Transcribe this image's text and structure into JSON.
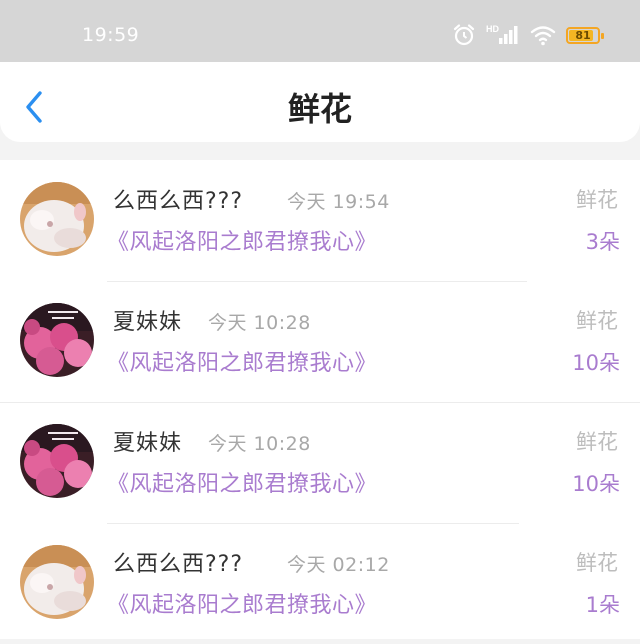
{
  "status_bar": {
    "time": "19:59",
    "hd_label": "HD",
    "battery_level": "81",
    "battery_fraction": 0.81,
    "icons": [
      "alarm-icon",
      "signal-icon",
      "wifi-icon",
      "battery-icon"
    ]
  },
  "header": {
    "title": "鲜花",
    "back_icon": "chevron-left-icon"
  },
  "colors": {
    "accent": "#a97ccf",
    "back": "#2b8ff0",
    "status_bar": "#d6d6d6",
    "battery": "#f4a623"
  },
  "items": [
    {
      "avatar": "kitten-avatar",
      "name": "么西么西???",
      "time": "今天 19:54",
      "book": "《风起洛阳之郎君撩我心》",
      "gift_type": "鲜花",
      "gift_count": "3朵"
    },
    {
      "avatar": "blossom-avatar",
      "name": "夏妹妹",
      "time": "今天 10:28",
      "book": "《风起洛阳之郎君撩我心》",
      "gift_type": "鲜花",
      "gift_count": "10朵"
    },
    {
      "avatar": "blossom-avatar",
      "name": "夏妹妹",
      "time": "今天 10:28",
      "book": "《风起洛阳之郎君撩我心》",
      "gift_type": "鲜花",
      "gift_count": "10朵"
    },
    {
      "avatar": "kitten-avatar",
      "name": "么西么西???",
      "time": "今天 02:12",
      "book": "《风起洛阳之郎君撩我心》",
      "gift_type": "鲜花",
      "gift_count": "1朵"
    }
  ]
}
